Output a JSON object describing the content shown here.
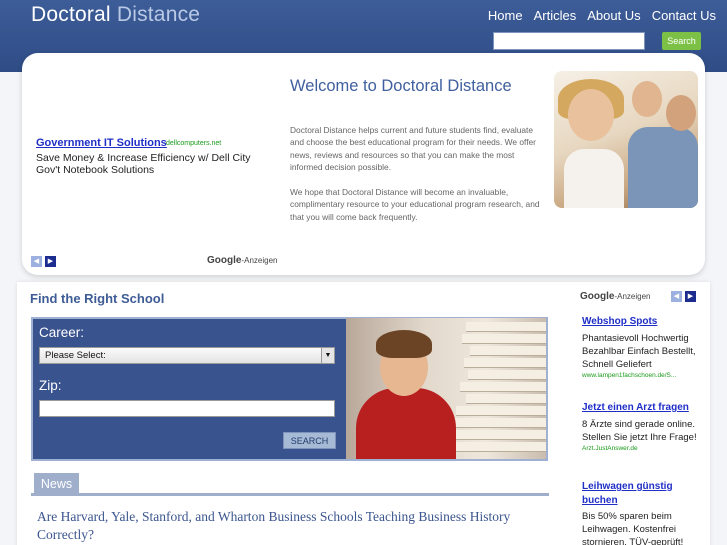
{
  "header": {
    "logo_main": "Doctoral",
    "logo_accent": "Distance",
    "nav": [
      "Home",
      "Articles",
      "About Us",
      "Contact Us"
    ],
    "search_placeholder": "",
    "search_button": "Search"
  },
  "top_ad": {
    "title": "Government IT Solutions",
    "domain": "dellcomputers.net",
    "description": "Save Money & Increase Efficiency w/ Dell City Gov't Notebook Solutions",
    "google_label": "Google",
    "anzeigen": "-Anzeigen",
    "prev_arrow": "◀",
    "next_arrow": "▶"
  },
  "welcome": {
    "title": "Welcome to Doctoral Distance",
    "paragraph1": "Doctoral Distance helps current and future students find, evaluate and choose the best educational program for their needs. We offer news, reviews and resources so that you can make the most informed decision possible.",
    "paragraph2": "We hope that Doctoral Distance will become an invaluable, complimentary resource to your educational program research, and that you will come back frequently."
  },
  "find_school": {
    "title": "Find the Right School",
    "career_label": "Career:",
    "career_value": "Please Select:",
    "zip_label": "Zip:",
    "zip_value": "",
    "submit": "SEARCH"
  },
  "news": {
    "tab": "News",
    "headline": "Are Harvard, Yale, Stanford, and Wharton Business Schools Teaching Business History Correctly?"
  },
  "sidebar": {
    "google_label": "Google",
    "anzeigen": "-Anzeigen",
    "prev_arrow": "◀",
    "next_arrow": "▶",
    "ads": [
      {
        "title": "Webshop Spots",
        "description": "Phantasievoll Hochwertig Bezahlbar Einfach Bestellt, Schnell Geliefert",
        "url": "www.lampen1fachschoen.de/S..."
      },
      {
        "title": "Jetzt einen Arzt fragen",
        "description": "8 Ärzte sind gerade online. Stellen Sie jetzt Ihre Frage!",
        "url": "Arzt.JustAnswer.de"
      },
      {
        "title": "Leihwagen günstig buchen",
        "description": "Bis 50% sparen beim Leihwagen. Kostenfrei stornieren. TÜV-geprüft!",
        "url": ""
      }
    ]
  },
  "colors": {
    "header_bg": "#2f4c86",
    "link": "#1f2ec7",
    "heading": "#3e5c95",
    "search_green": "#7cc146"
  }
}
